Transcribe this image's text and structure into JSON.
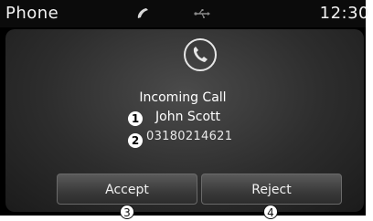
{
  "status_bar": {
    "title": "Phone",
    "time": "12:30",
    "icons": [
      "phone-handset-icon",
      "usb-icon"
    ]
  },
  "call": {
    "icon": "phone-call-icon",
    "status": "Incoming Call",
    "caller_name": "John Scott",
    "caller_number": "03180214621"
  },
  "actions": {
    "accept_label": "Accept",
    "reject_label": "Reject"
  },
  "callouts": {
    "name_marker": "1",
    "number_marker": "2",
    "accept_marker": "3",
    "reject_marker": "4"
  }
}
